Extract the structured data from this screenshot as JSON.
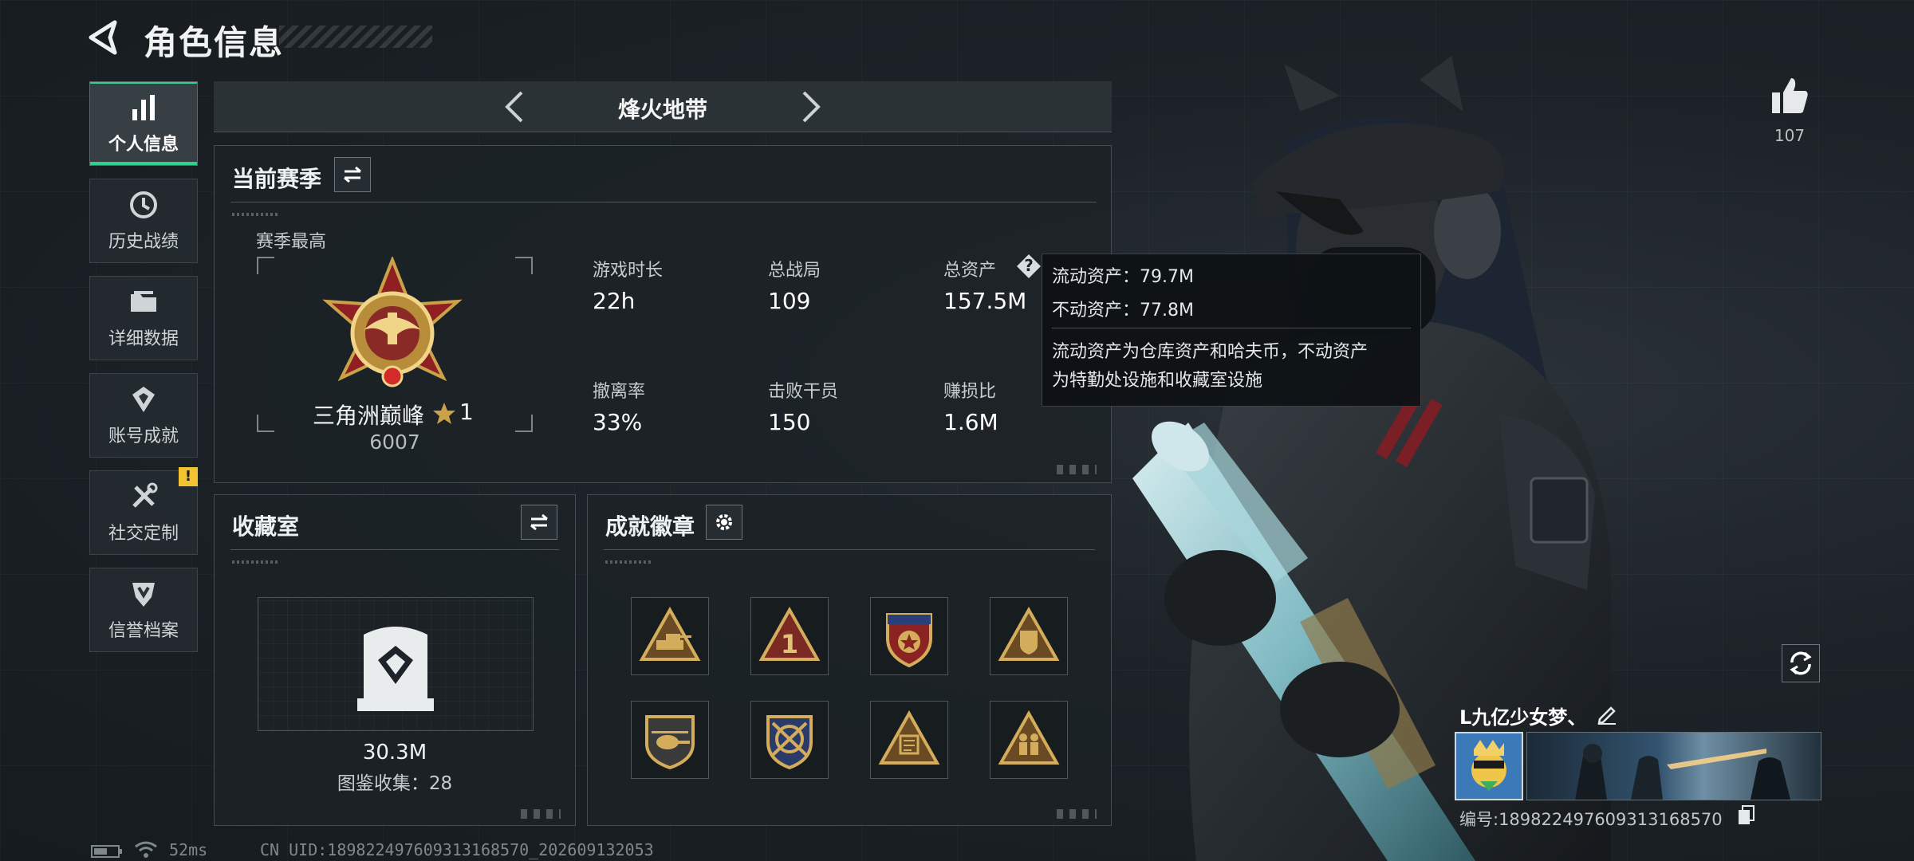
{
  "header": {
    "title": "角色信息"
  },
  "nav": {
    "items": [
      {
        "label": "个人信息",
        "icon": "bar-chart-icon",
        "active": true
      },
      {
        "label": "历史战绩",
        "icon": "history-clock-icon",
        "active": false
      },
      {
        "label": "详细数据",
        "icon": "folder-icon",
        "active": false
      },
      {
        "label": "账号成就",
        "icon": "achievement-icon",
        "active": false
      },
      {
        "label": "社交定制",
        "icon": "tools-icon",
        "active": false
      },
      {
        "label": "信誉档案",
        "icon": "credit-shield-icon",
        "active": false
      }
    ],
    "warning_badge": "!"
  },
  "mode": {
    "title": "烽火地带"
  },
  "season": {
    "title": "当前赛季",
    "best_label": "赛季最高",
    "rank_name": "三角洲巅峰",
    "rank_stars": "1",
    "rank_score": "6007",
    "stats": [
      {
        "label": "游戏时长",
        "value": "22h"
      },
      {
        "label": "总战局",
        "value": "109"
      },
      {
        "label": "总资产",
        "value": "157.5M"
      },
      {
        "label": "撤离率",
        "value": "33%"
      },
      {
        "label": "击败干员",
        "value": "150"
      },
      {
        "label": "赚损比",
        "value": "1.6M"
      }
    ],
    "help_glyph": "?"
  },
  "tooltip": {
    "liquid": "流动资产：79.7M",
    "fixed": "不动资产：77.8M",
    "desc_line1": "流动资产为仓库资产和哈夫币，不动资产",
    "desc_line2": "为特勤处设施和收藏室设施"
  },
  "collection": {
    "title": "收藏室",
    "value": "30.3M",
    "catalog": "图鉴收集：28"
  },
  "achievements": {
    "title": "成就徽章",
    "badges": [
      {
        "icon": "tank-triangle-badge"
      },
      {
        "icon": "number-one-triangle-badge"
      },
      {
        "icon": "star-shield-badge"
      },
      {
        "icon": "shield-triangle-badge"
      },
      {
        "icon": "helicopter-shield-badge"
      },
      {
        "icon": "crossed-rifles-badge"
      },
      {
        "icon": "map-triangle-badge"
      },
      {
        "icon": "soldiers-triangle-badge"
      }
    ]
  },
  "footer": {
    "latency": "52ms",
    "uid": "CN UID:1898224976093131685​70_202609132053"
  },
  "profile": {
    "likes": "107",
    "player_name": "L九亿少女梦、",
    "player_id": "编号:189822497609313168570"
  },
  "colors": {
    "accent": "#2fd28c",
    "warning": "#f2c230",
    "gold": "#c9a24a"
  }
}
